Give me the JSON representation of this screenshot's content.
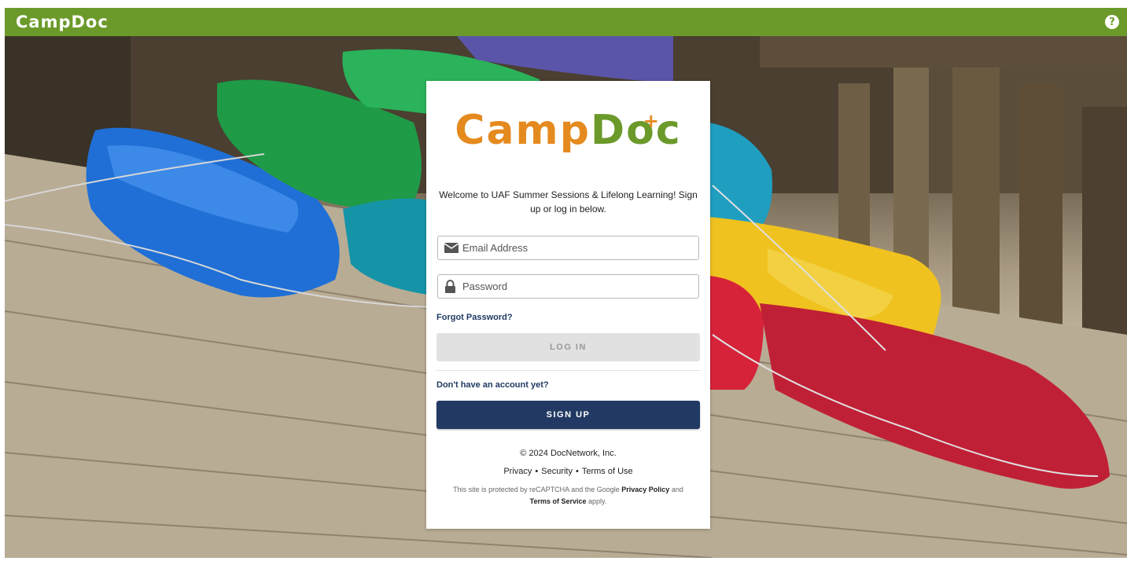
{
  "topbar": {
    "brand": "CampDoc",
    "help_icon": "question-circle-icon"
  },
  "hero": {
    "description_icon": "kayaks-photo"
  },
  "card": {
    "logo_camp": "Camp",
    "logo_d": "D",
    "logo_o": "o",
    "logo_c": "c",
    "welcome": "Welcome to UAF Summer Sessions & Lifelong Learning! Sign up or log in below.",
    "email_placeholder": "Email Address",
    "password_placeholder": "Password",
    "forgot": "Forgot Password?",
    "login": "LOG IN",
    "no_account": "Don't have an account yet?",
    "signup": "SIGN UP",
    "copyright": "© 2024 DocNetwork, Inc.",
    "links": {
      "privacy": "Privacy",
      "security": "Security",
      "terms": "Terms of Use",
      "separator": "•"
    },
    "recaptcha": {
      "prefix": "This site is protected by reCAPTCHA and the Google",
      "privacy_policy": "Privacy Policy",
      "and": "and",
      "terms_of_service": "Terms of Service",
      "apply": "apply."
    }
  },
  "colors": {
    "brand_green": "#6b9a2a",
    "brand_orange": "#e58a1f",
    "navy": "#223a63"
  }
}
